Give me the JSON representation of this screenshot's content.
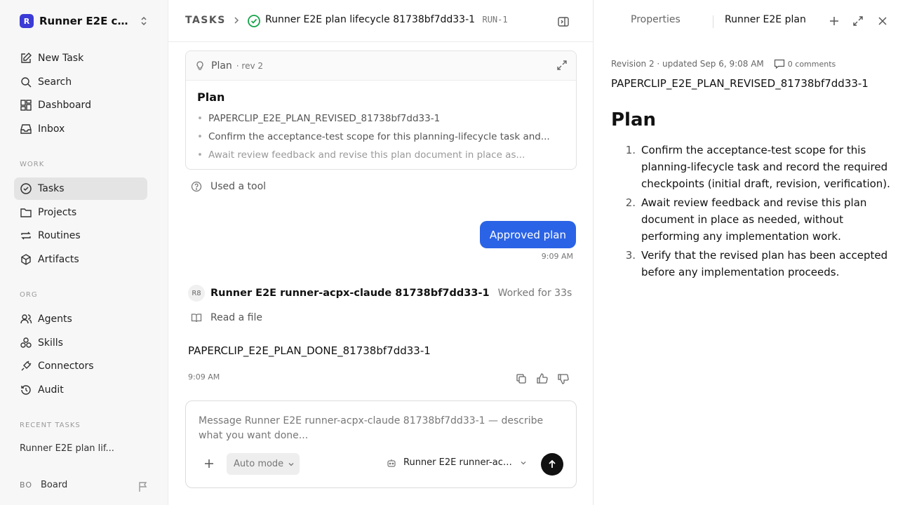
{
  "workspace": {
    "logo": "R",
    "name": "Runner E2E co..."
  },
  "nav": {
    "top": [
      {
        "label": "New Task",
        "icon": "edit-icon"
      },
      {
        "label": "Search",
        "icon": "search-icon"
      },
      {
        "label": "Dashboard",
        "icon": "dashboard-icon"
      },
      {
        "label": "Inbox",
        "icon": "inbox-icon"
      }
    ],
    "work_label": "WORK",
    "work": [
      {
        "label": "Tasks",
        "icon": "check-circle-icon",
        "active": true
      },
      {
        "label": "Projects",
        "icon": "folder-icon"
      },
      {
        "label": "Routines",
        "icon": "repeat-icon"
      },
      {
        "label": "Artifacts",
        "icon": "box-icon"
      }
    ],
    "org_label": "ORG",
    "org": [
      {
        "label": "Agents",
        "icon": "users-icon"
      },
      {
        "label": "Skills",
        "icon": "skills-icon"
      },
      {
        "label": "Connectors",
        "icon": "plug-icon"
      },
      {
        "label": "Audit",
        "icon": "history-icon"
      }
    ],
    "recent_label": "RECENT TASKS",
    "recent": [
      {
        "label": "Runner E2E plan lif..."
      }
    ],
    "board": {
      "initials": "BO",
      "label": "Board"
    }
  },
  "header": {
    "section": "TASKS",
    "task_title": "Runner E2E plan lifecycle 81738bf7dd33-1",
    "run_id": "RUN-1"
  },
  "plan_card": {
    "label": "Plan",
    "revision": "· rev 2",
    "heading": "Plan",
    "items": [
      "PAPERCLIP_E2E_PLAN_REVISED_81738bf7dd33-1",
      "Confirm the acceptance-test scope for this planning-lifecycle task and...",
      "Await review feedback and revise this plan document in place as..."
    ]
  },
  "tool_event": {
    "label": "Used a tool"
  },
  "user_message": {
    "text": "Approved plan",
    "time": "9:09 AM"
  },
  "agent_message": {
    "avatar": "R8",
    "name": "Runner E2E runner-acpx-claude 81738bf7dd33-1",
    "duration": "Worked for 33s",
    "action": "Read a file",
    "result": "PAPERCLIP_E2E_PLAN_DONE_81738bf7dd33-1",
    "time": "9:09 AM"
  },
  "composer": {
    "placeholder": "Message Runner E2E runner-acpx-claude 81738bf7dd33-1 — describe what you want done...",
    "mode": "Auto mode",
    "agent": "Runner E2E runner-acpx..."
  },
  "right_panel": {
    "tabs": {
      "properties": "Properties",
      "document": "Runner E2E plan"
    },
    "meta": "Revision 2 · updated Sep 6, 9:08 AM",
    "comments": "0 comments",
    "doc_id": "PAPERCLIP_E2E_PLAN_REVISED_81738bf7dd33-1",
    "heading": "Plan",
    "items": [
      {
        "num": "1.",
        "text": "Confirm the acceptance-test scope for this planning-lifecycle task and record the required checkpoints (initial draft, revision, verification)."
      },
      {
        "num": "2.",
        "text": "Await review feedback and revise this plan document in place as needed, without performing any implementation work."
      },
      {
        "num": "3.",
        "text": "Verify that the revised plan has been accepted before any implementation proceeds."
      }
    ]
  },
  "colors": {
    "accent": "#2b63e6",
    "success": "#16a34a",
    "brand": "#3b3bd6"
  }
}
